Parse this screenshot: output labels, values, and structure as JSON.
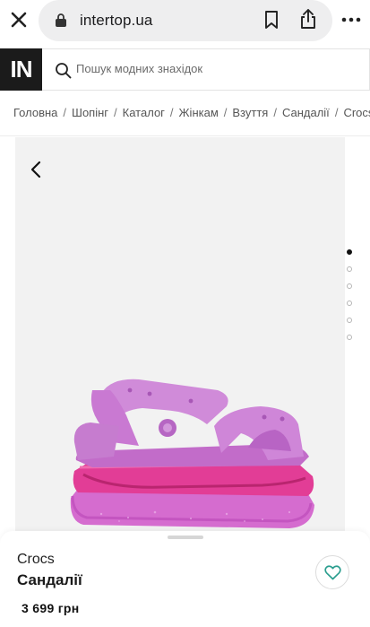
{
  "browser": {
    "url": "intertop.ua",
    "icons": [
      "close-icon",
      "lock-icon",
      "bookmark-icon",
      "share-icon",
      "more-icon"
    ]
  },
  "header": {
    "logo": "IN",
    "search_placeholder": "Пошук модних знахідок"
  },
  "breadcrumbs": [
    "Головна",
    "Шопінг",
    "Каталог",
    "Жінкам",
    "Взуття",
    "Сандалії",
    "Crocs"
  ],
  "breadcrumb_separator": "/",
  "gallery": {
    "image_count": 6,
    "active_index": 0,
    "product_colors": {
      "upper": "#c97fd3",
      "sole": "#e23d96",
      "platform": "#d56ccf"
    }
  },
  "product": {
    "brand": "Crocs",
    "name": "Сандалії",
    "price": "3 699 грн"
  },
  "colors": {
    "accent": "#2b9e8f",
    "logo_bg": "#1b1b1b"
  }
}
